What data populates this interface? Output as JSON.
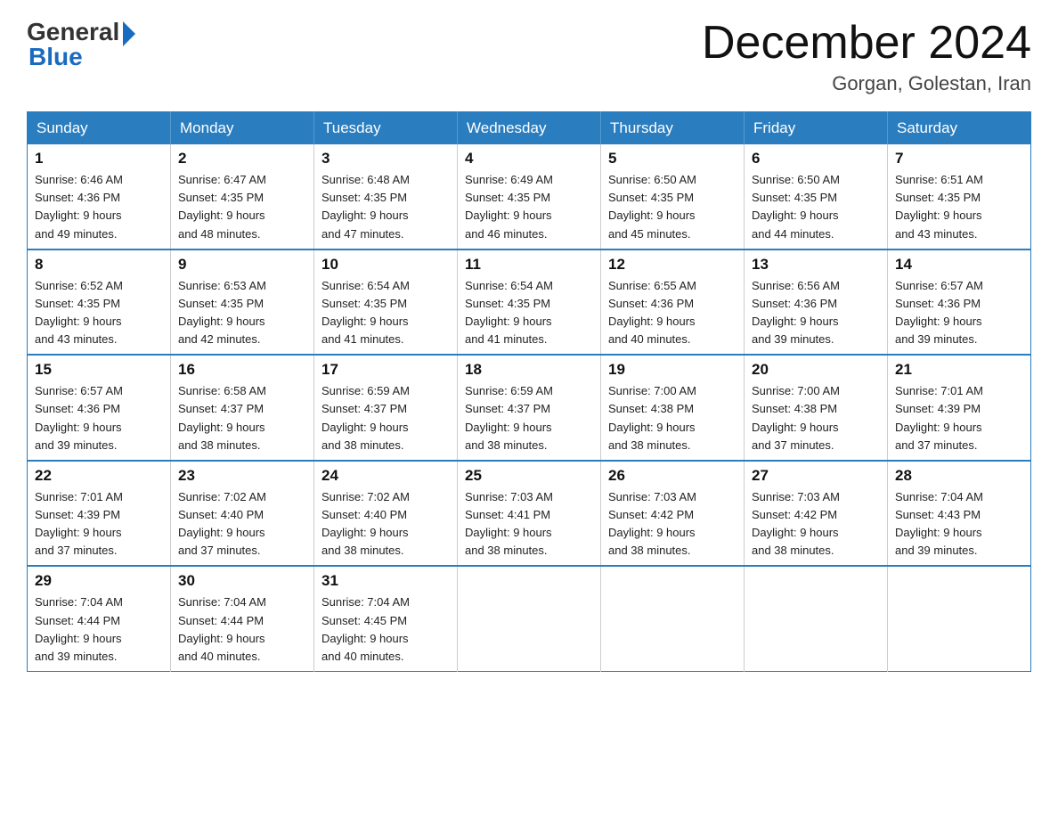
{
  "header": {
    "logo_general": "General",
    "logo_blue": "Blue",
    "title": "December 2024",
    "location": "Gorgan, Golestan, Iran"
  },
  "days_of_week": [
    "Sunday",
    "Monday",
    "Tuesday",
    "Wednesday",
    "Thursday",
    "Friday",
    "Saturday"
  ],
  "weeks": [
    [
      {
        "day": "1",
        "sunrise": "6:46 AM",
        "sunset": "4:36 PM",
        "daylight": "9 hours and 49 minutes."
      },
      {
        "day": "2",
        "sunrise": "6:47 AM",
        "sunset": "4:35 PM",
        "daylight": "9 hours and 48 minutes."
      },
      {
        "day": "3",
        "sunrise": "6:48 AM",
        "sunset": "4:35 PM",
        "daylight": "9 hours and 47 minutes."
      },
      {
        "day": "4",
        "sunrise": "6:49 AM",
        "sunset": "4:35 PM",
        "daylight": "9 hours and 46 minutes."
      },
      {
        "day": "5",
        "sunrise": "6:50 AM",
        "sunset": "4:35 PM",
        "daylight": "9 hours and 45 minutes."
      },
      {
        "day": "6",
        "sunrise": "6:50 AM",
        "sunset": "4:35 PM",
        "daylight": "9 hours and 44 minutes."
      },
      {
        "day": "7",
        "sunrise": "6:51 AM",
        "sunset": "4:35 PM",
        "daylight": "9 hours and 43 minutes."
      }
    ],
    [
      {
        "day": "8",
        "sunrise": "6:52 AM",
        "sunset": "4:35 PM",
        "daylight": "9 hours and 43 minutes."
      },
      {
        "day": "9",
        "sunrise": "6:53 AM",
        "sunset": "4:35 PM",
        "daylight": "9 hours and 42 minutes."
      },
      {
        "day": "10",
        "sunrise": "6:54 AM",
        "sunset": "4:35 PM",
        "daylight": "9 hours and 41 minutes."
      },
      {
        "day": "11",
        "sunrise": "6:54 AM",
        "sunset": "4:35 PM",
        "daylight": "9 hours and 41 minutes."
      },
      {
        "day": "12",
        "sunrise": "6:55 AM",
        "sunset": "4:36 PM",
        "daylight": "9 hours and 40 minutes."
      },
      {
        "day": "13",
        "sunrise": "6:56 AM",
        "sunset": "4:36 PM",
        "daylight": "9 hours and 39 minutes."
      },
      {
        "day": "14",
        "sunrise": "6:57 AM",
        "sunset": "4:36 PM",
        "daylight": "9 hours and 39 minutes."
      }
    ],
    [
      {
        "day": "15",
        "sunrise": "6:57 AM",
        "sunset": "4:36 PM",
        "daylight": "9 hours and 39 minutes."
      },
      {
        "day": "16",
        "sunrise": "6:58 AM",
        "sunset": "4:37 PM",
        "daylight": "9 hours and 38 minutes."
      },
      {
        "day": "17",
        "sunrise": "6:59 AM",
        "sunset": "4:37 PM",
        "daylight": "9 hours and 38 minutes."
      },
      {
        "day": "18",
        "sunrise": "6:59 AM",
        "sunset": "4:37 PM",
        "daylight": "9 hours and 38 minutes."
      },
      {
        "day": "19",
        "sunrise": "7:00 AM",
        "sunset": "4:38 PM",
        "daylight": "9 hours and 38 minutes."
      },
      {
        "day": "20",
        "sunrise": "7:00 AM",
        "sunset": "4:38 PM",
        "daylight": "9 hours and 37 minutes."
      },
      {
        "day": "21",
        "sunrise": "7:01 AM",
        "sunset": "4:39 PM",
        "daylight": "9 hours and 37 minutes."
      }
    ],
    [
      {
        "day": "22",
        "sunrise": "7:01 AM",
        "sunset": "4:39 PM",
        "daylight": "9 hours and 37 minutes."
      },
      {
        "day": "23",
        "sunrise": "7:02 AM",
        "sunset": "4:40 PM",
        "daylight": "9 hours and 37 minutes."
      },
      {
        "day": "24",
        "sunrise": "7:02 AM",
        "sunset": "4:40 PM",
        "daylight": "9 hours and 38 minutes."
      },
      {
        "day": "25",
        "sunrise": "7:03 AM",
        "sunset": "4:41 PM",
        "daylight": "9 hours and 38 minutes."
      },
      {
        "day": "26",
        "sunrise": "7:03 AM",
        "sunset": "4:42 PM",
        "daylight": "9 hours and 38 minutes."
      },
      {
        "day": "27",
        "sunrise": "7:03 AM",
        "sunset": "4:42 PM",
        "daylight": "9 hours and 38 minutes."
      },
      {
        "day": "28",
        "sunrise": "7:04 AM",
        "sunset": "4:43 PM",
        "daylight": "9 hours and 39 minutes."
      }
    ],
    [
      {
        "day": "29",
        "sunrise": "7:04 AM",
        "sunset": "4:44 PM",
        "daylight": "9 hours and 39 minutes."
      },
      {
        "day": "30",
        "sunrise": "7:04 AM",
        "sunset": "4:44 PM",
        "daylight": "9 hours and 40 minutes."
      },
      {
        "day": "31",
        "sunrise": "7:04 AM",
        "sunset": "4:45 PM",
        "daylight": "9 hours and 40 minutes."
      },
      null,
      null,
      null,
      null
    ]
  ],
  "labels": {
    "sunrise": "Sunrise: ",
    "sunset": "Sunset: ",
    "daylight": "Daylight: "
  }
}
